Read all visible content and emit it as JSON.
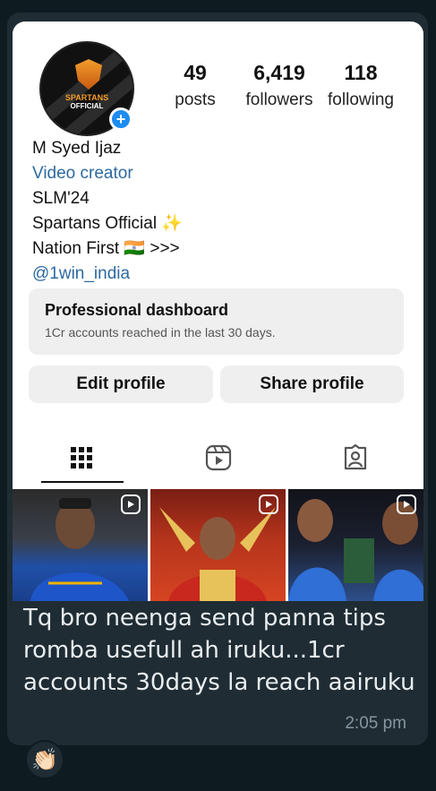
{
  "profile": {
    "avatar_line1": "SPARTANS",
    "avatar_line2": "OFFICIAL",
    "posts_count": "49",
    "posts_label": "posts",
    "followers_count": "6,419",
    "followers_label": "followers",
    "following_count": "118",
    "following_label": "following",
    "name": "M Syed Ijaz",
    "category": "Video creator",
    "bio_line1": "SLM'24",
    "bio_line2": "Spartans Official ✨",
    "bio_line3": "Nation First 🇮🇳 >>>",
    "link": "@1win_india"
  },
  "dashboard": {
    "title": "Professional dashboard",
    "subtitle": "1Cr accounts reached in the last 30 days."
  },
  "buttons": {
    "edit": "Edit profile",
    "share": "Share profile"
  },
  "tabs": [
    "grid-icon",
    "reels-icon",
    "tagged-icon"
  ],
  "message": {
    "text": "Tq bro neenga send panna tips romba usefull ah iruku...1cr accounts 30days la reach aairuku",
    "time": "2:05 pm",
    "reaction": "👏🏻"
  },
  "colors": {
    "bubble": "#1f2c34",
    "link_blue": "#2d6aa0",
    "badge_blue": "#1d8cf0"
  }
}
